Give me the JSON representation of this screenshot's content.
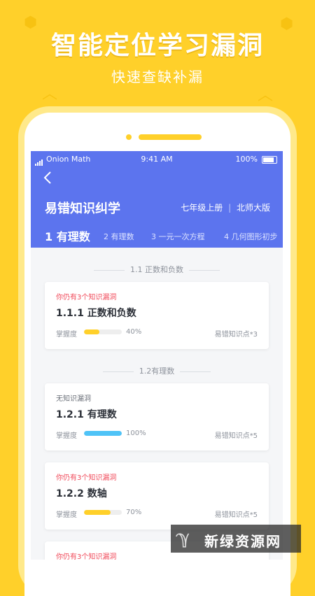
{
  "promo": {
    "headline": "智能定位学习漏洞",
    "subline": "快速查缺补漏"
  },
  "colors": {
    "background": "#FFD02A",
    "header": "#5C74EE",
    "alert_red": "#F04A5A",
    "bar_yellow": "#FFD02A",
    "bar_blue": "#4FC3F7"
  },
  "status_bar": {
    "carrier": "Onion Math",
    "time": "9:41 AM",
    "battery": "100%"
  },
  "header": {
    "back_icon": "chevron-left-icon",
    "title": "易错知识纠学",
    "grade": "七年级上册",
    "separator": "|",
    "edition": "北师大版"
  },
  "tabs": [
    {
      "label": "1 有理数",
      "active": true
    },
    {
      "label": "2 有理数",
      "active": false
    },
    {
      "label": "3 一元一次方程",
      "active": false
    },
    {
      "label": "4 几何图形初步",
      "active": false
    }
  ],
  "sections": [
    {
      "label": "1.1 正数和负数"
    },
    {
      "label": "1.2有理数"
    }
  ],
  "cards": [
    {
      "alert": "你仍有3个知识漏洞",
      "alert_type": "red",
      "title": "1.1.1 正数和负数",
      "mastery_label": "掌握度",
      "percent_text": "40%",
      "percent": 0.4,
      "bar_color": "#FFD02A",
      "error_points": "易错知识点*3"
    },
    {
      "alert": "无知识漏洞",
      "alert_type": "gray",
      "title": "1.2.1 有理数",
      "mastery_label": "掌握度",
      "percent_text": "100%",
      "percent": 1.0,
      "bar_color": "#4FC3F7",
      "error_points": "易错知识点*5"
    },
    {
      "alert": "你仍有3个知识漏洞",
      "alert_type": "red",
      "title": "1.2.2 数轴",
      "mastery_label": "掌握度",
      "percent_text": "70%",
      "percent": 0.7,
      "bar_color": "#FFD02A",
      "error_points": "易错知识点*5"
    },
    {
      "alert": "你仍有3个知识漏洞",
      "alert_type": "red",
      "title": "",
      "mastery_label": "",
      "percent_text": "",
      "percent": 0,
      "bar_color": "#FFD02A",
      "error_points": ""
    }
  ],
  "watermark": {
    "text": "新绿资源网"
  }
}
